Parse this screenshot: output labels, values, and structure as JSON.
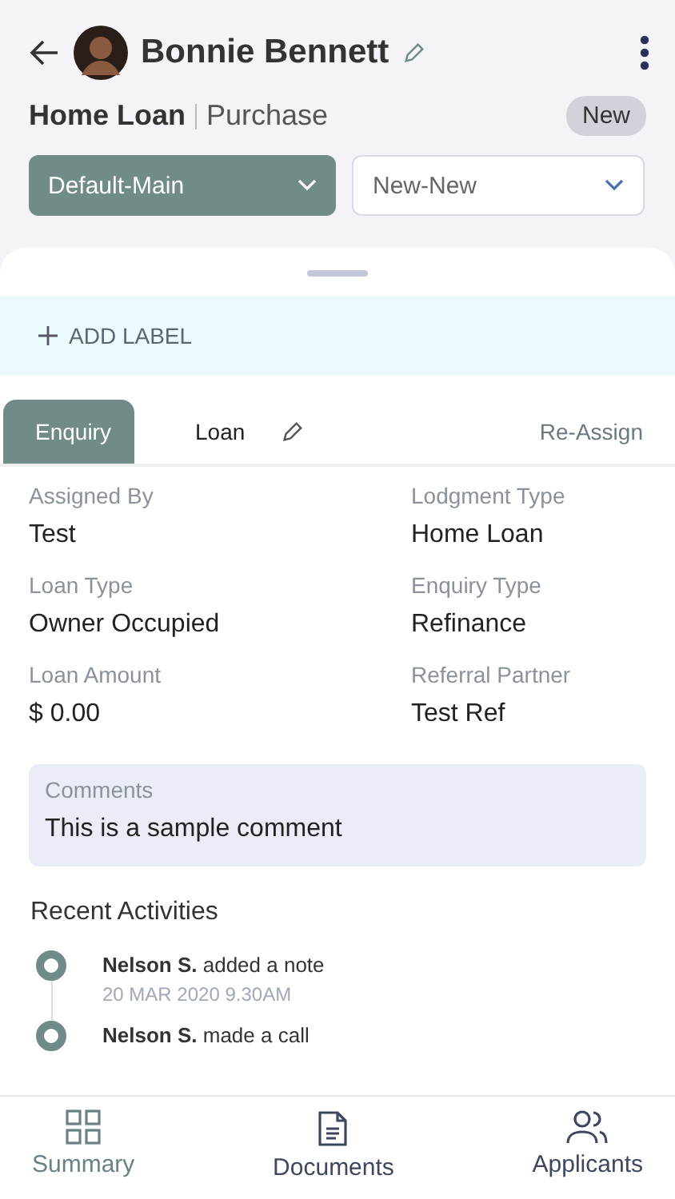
{
  "header": {
    "name": "Bonnie Bennett",
    "loan_type": "Home Loan",
    "loan_purpose": "Purchase",
    "status": "New"
  },
  "dropdowns": [
    {
      "value": "Default-Main",
      "kind": "filled"
    },
    {
      "value": "New-New",
      "kind": "outline"
    }
  ],
  "add_label": "ADD LABEL",
  "tabs": [
    {
      "label": "Enquiry",
      "selected": true,
      "editable": false
    },
    {
      "label": "Loan",
      "selected": false,
      "editable": true
    }
  ],
  "reassign": "Re-Assign",
  "fields": [
    {
      "label": "Assigned By",
      "value": "Test"
    },
    {
      "label": "Lodgment Type",
      "value": "Home Loan"
    },
    {
      "label": "Loan Type",
      "value": "Owner Occupied"
    },
    {
      "label": "Enquiry Type",
      "value": "Refinance"
    },
    {
      "label": "Loan Amount",
      "value": "$ 0.00"
    },
    {
      "label": "Referral Partner",
      "value": "Test Ref"
    }
  ],
  "comments": {
    "label": "Comments",
    "value": "This is a sample comment"
  },
  "recent_activities": {
    "title": "Recent Activities",
    "items": [
      {
        "actor": "Nelson S.",
        "action": "added a note",
        "time": "20 MAR 2020  9.30AM"
      },
      {
        "actor": "Nelson S.",
        "action": "made a call"
      }
    ]
  },
  "nav": [
    {
      "label": "Summary",
      "kind": "grid",
      "selected": true
    },
    {
      "label": "Documents",
      "kind": "document",
      "selected": false
    },
    {
      "label": "Applicants",
      "kind": "people",
      "selected": false
    }
  ]
}
